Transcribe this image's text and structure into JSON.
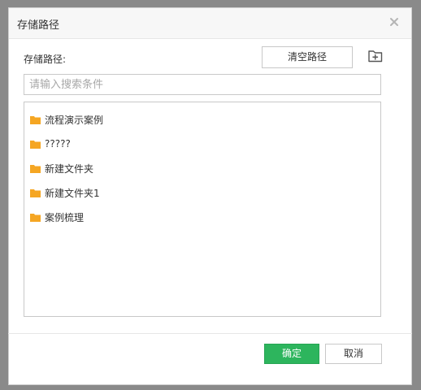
{
  "dialog": {
    "title": "存储路径",
    "close_icon": "close-icon"
  },
  "form": {
    "path_label": "存储路径:",
    "clear_button_label": "清空路径",
    "new_folder_icon": "new-folder-icon",
    "search_placeholder": "请输入搜索条件",
    "search_value": ""
  },
  "folders": [
    {
      "label": "流程演示案例",
      "icon": "folder-icon"
    },
    {
      "label": "?????",
      "icon": "folder-icon"
    },
    {
      "label": "新建文件夹",
      "icon": "folder-icon"
    },
    {
      "label": "新建文件夹1",
      "icon": "folder-icon"
    },
    {
      "label": "案例梳理",
      "icon": "folder-icon"
    }
  ],
  "footer": {
    "ok_label": "确定",
    "cancel_label": "取消"
  },
  "colors": {
    "accent_green": "#2db55d",
    "folder_orange": "#f5a623",
    "border": "#c8c8c8"
  }
}
